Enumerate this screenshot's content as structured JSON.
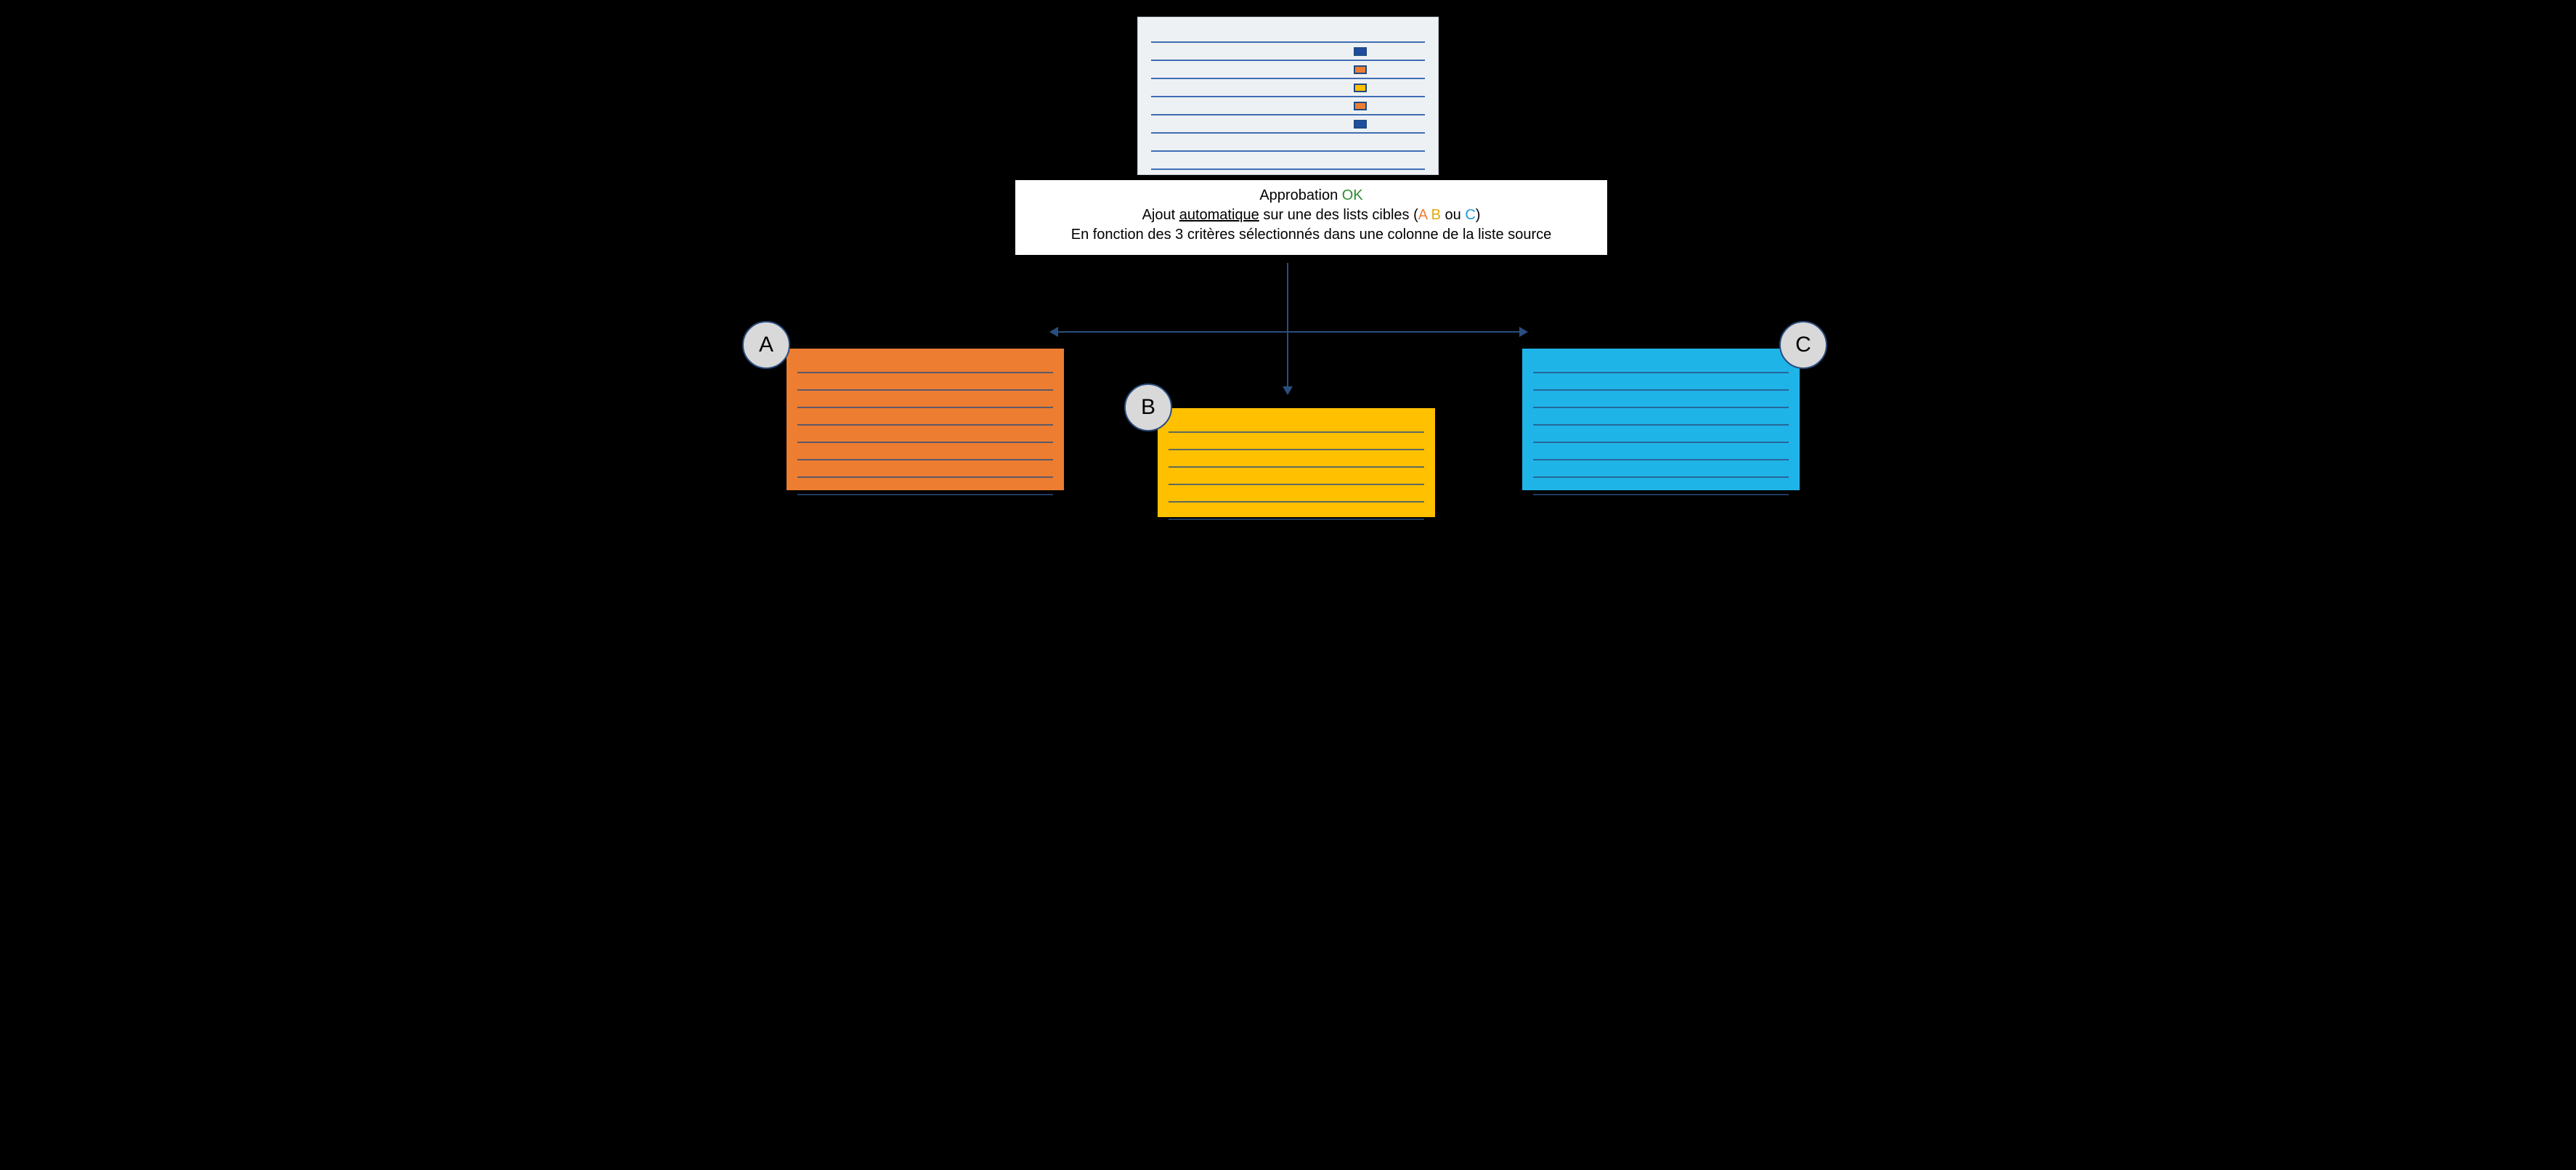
{
  "source": {
    "rows": [
      {
        "marker": null
      },
      {
        "marker": "blue"
      },
      {
        "marker": "orange"
      },
      {
        "marker": "yellow"
      },
      {
        "marker": "orange"
      },
      {
        "marker": "blue"
      },
      {
        "marker": null
      },
      {
        "marker": null
      },
      {
        "marker": null
      }
    ]
  },
  "caption": {
    "line1_prefix": "Approbation ",
    "line1_ok": "OK",
    "line2_pre": "Ajout ",
    "line2_auto": "automatique",
    "line2_mid": " sur une des lists cibles ",
    "paren_open": "(",
    "a": "A",
    "space1": " ",
    "b": "B",
    "ou": " ou ",
    "c": "C",
    "paren_close": ")",
    "line3": "En fonction des 3 critères sélectionnés dans une colonne de la liste source"
  },
  "targets": {
    "a_label": "A",
    "b_label": "B",
    "c_label": "C",
    "a_rows": 8,
    "b_rows": 6,
    "c_rows": 8
  },
  "colors": {
    "orange": "#ed7d31",
    "yellow": "#ffc000",
    "blue": "#1fb4e8",
    "line": "#2a4d7f"
  }
}
